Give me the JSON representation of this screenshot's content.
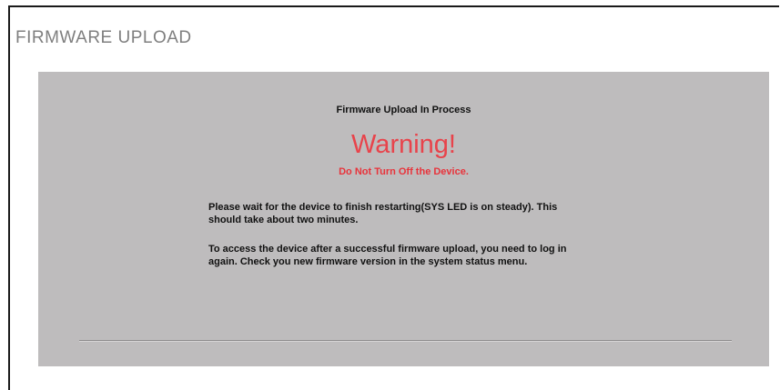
{
  "page": {
    "title": "FIRMWARE UPLOAD"
  },
  "panel": {
    "subtitle": "Firmware Upload In Process",
    "warning_title": "Warning!",
    "warning_subtitle": "Do Not Turn Off the Device.",
    "paragraphs": [
      "Please wait for the device to finish restarting(SYS LED is on steady). This should take about two minutes.",
      "To access the device after a successful firmware upload, you need to log in again. Check you new firmware version in the system status menu."
    ]
  },
  "colors": {
    "title_gray": "#7f7f7f",
    "panel_background": "#bebcbd",
    "warning_red": "#e8434b"
  }
}
